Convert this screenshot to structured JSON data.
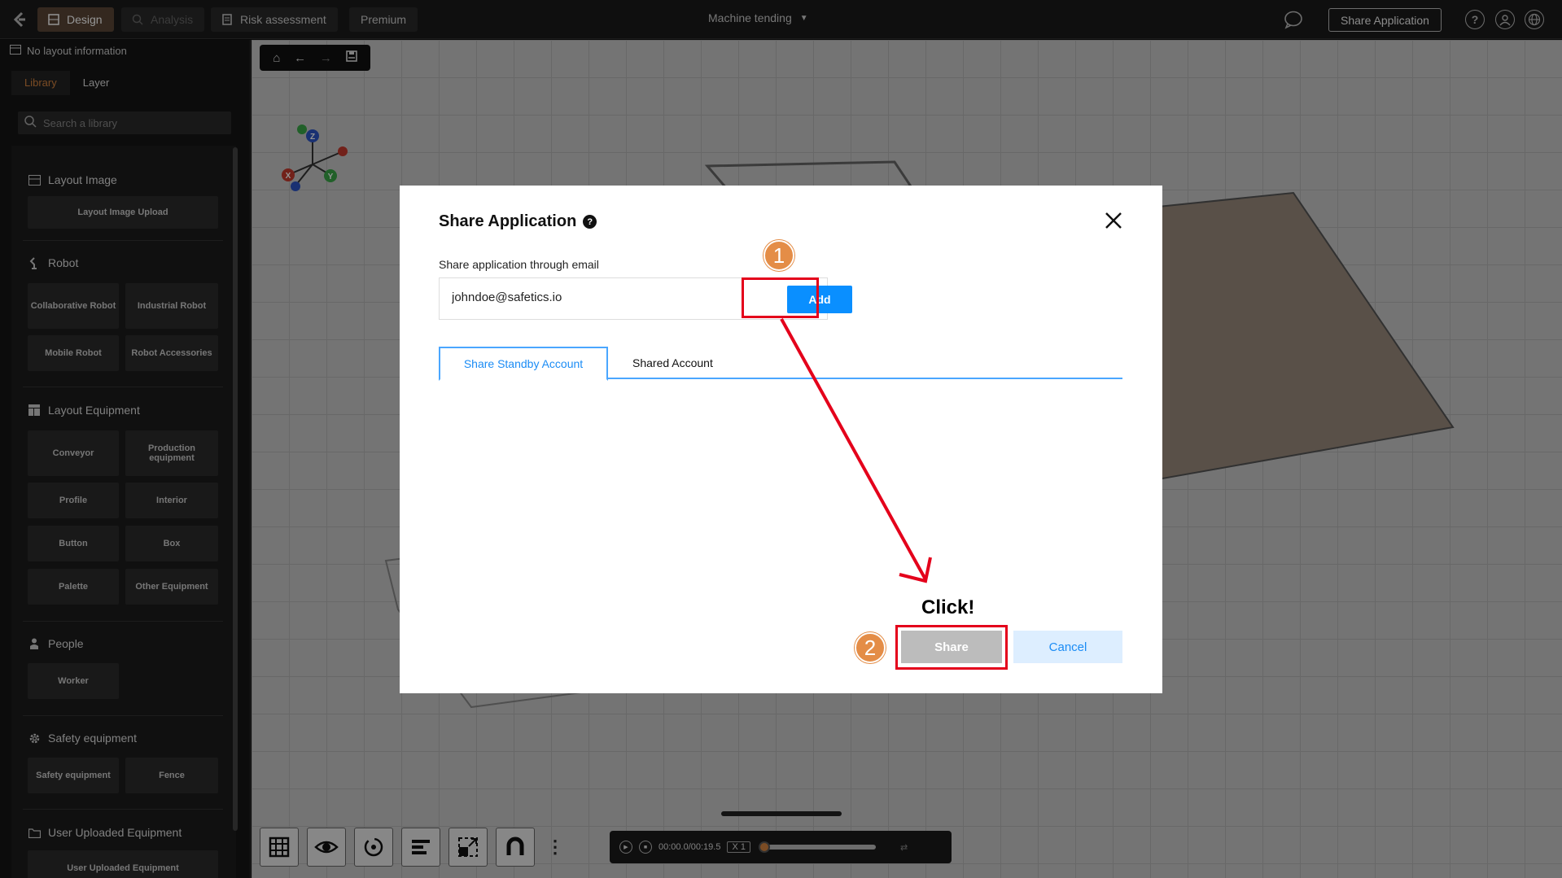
{
  "topbar": {
    "back_icon": "back-arrow-icon",
    "nav": [
      {
        "label": "Design",
        "icon": "grid-icon",
        "active": true
      },
      {
        "label": "Analysis",
        "icon": "analysis-icon",
        "disabled": true
      },
      {
        "label": "Risk assessment",
        "icon": "document-icon"
      },
      {
        "label": "Premium"
      }
    ],
    "project_title": "Machine tending",
    "share_application_label": "Share Application",
    "help_icon": "?",
    "user_icon": "user-icon",
    "language_icon": "globe-icon"
  },
  "left_panel": {
    "layout_info": "No layout information",
    "tabs": [
      "Library",
      "Layer"
    ],
    "search_placeholder": "Search a library",
    "sections": [
      {
        "title": "Layout Image",
        "icon": "image-icon",
        "items": [
          "Layout Image Upload"
        ]
      },
      {
        "title": "Robot",
        "icon": "robot-arm-icon",
        "items": [
          "Collaborative Robot",
          "Industrial Robot",
          "Mobile Robot",
          "Robot Accessories"
        ]
      },
      {
        "title": "Layout Equipment",
        "icon": "layout-icon",
        "items": [
          "Conveyor",
          "Production equipment",
          "Profile",
          "Interior",
          "Button",
          "Box",
          "Palette",
          "Other Equipment"
        ]
      },
      {
        "title": "People",
        "icon": "person-icon",
        "items": [
          "Worker"
        ]
      },
      {
        "title": "Safety equipment",
        "icon": "gear-icon",
        "items": [
          "Safety equipment",
          "Fence"
        ]
      },
      {
        "title": "User Uploaded Equipment",
        "icon": "folder-icon",
        "items": [
          "User Uploaded Equipment"
        ]
      }
    ]
  },
  "timeline": {
    "time": "00:00.0/00:19.5",
    "speed": "X 1"
  },
  "modal": {
    "title": "Share Application",
    "help_icon": "?",
    "email_label": "Share application through email",
    "email_value": "johndoe@safetics.io",
    "add_label": "Add",
    "tabs": [
      "Share Standby Account",
      "Shared Account"
    ],
    "share_label": "Share",
    "cancel_label": "Cancel"
  },
  "annotations": {
    "step1": "1",
    "step2": "2",
    "click_text": "Click!",
    "highlight_color": "#e4001b",
    "badge_color": "#e48d47"
  }
}
